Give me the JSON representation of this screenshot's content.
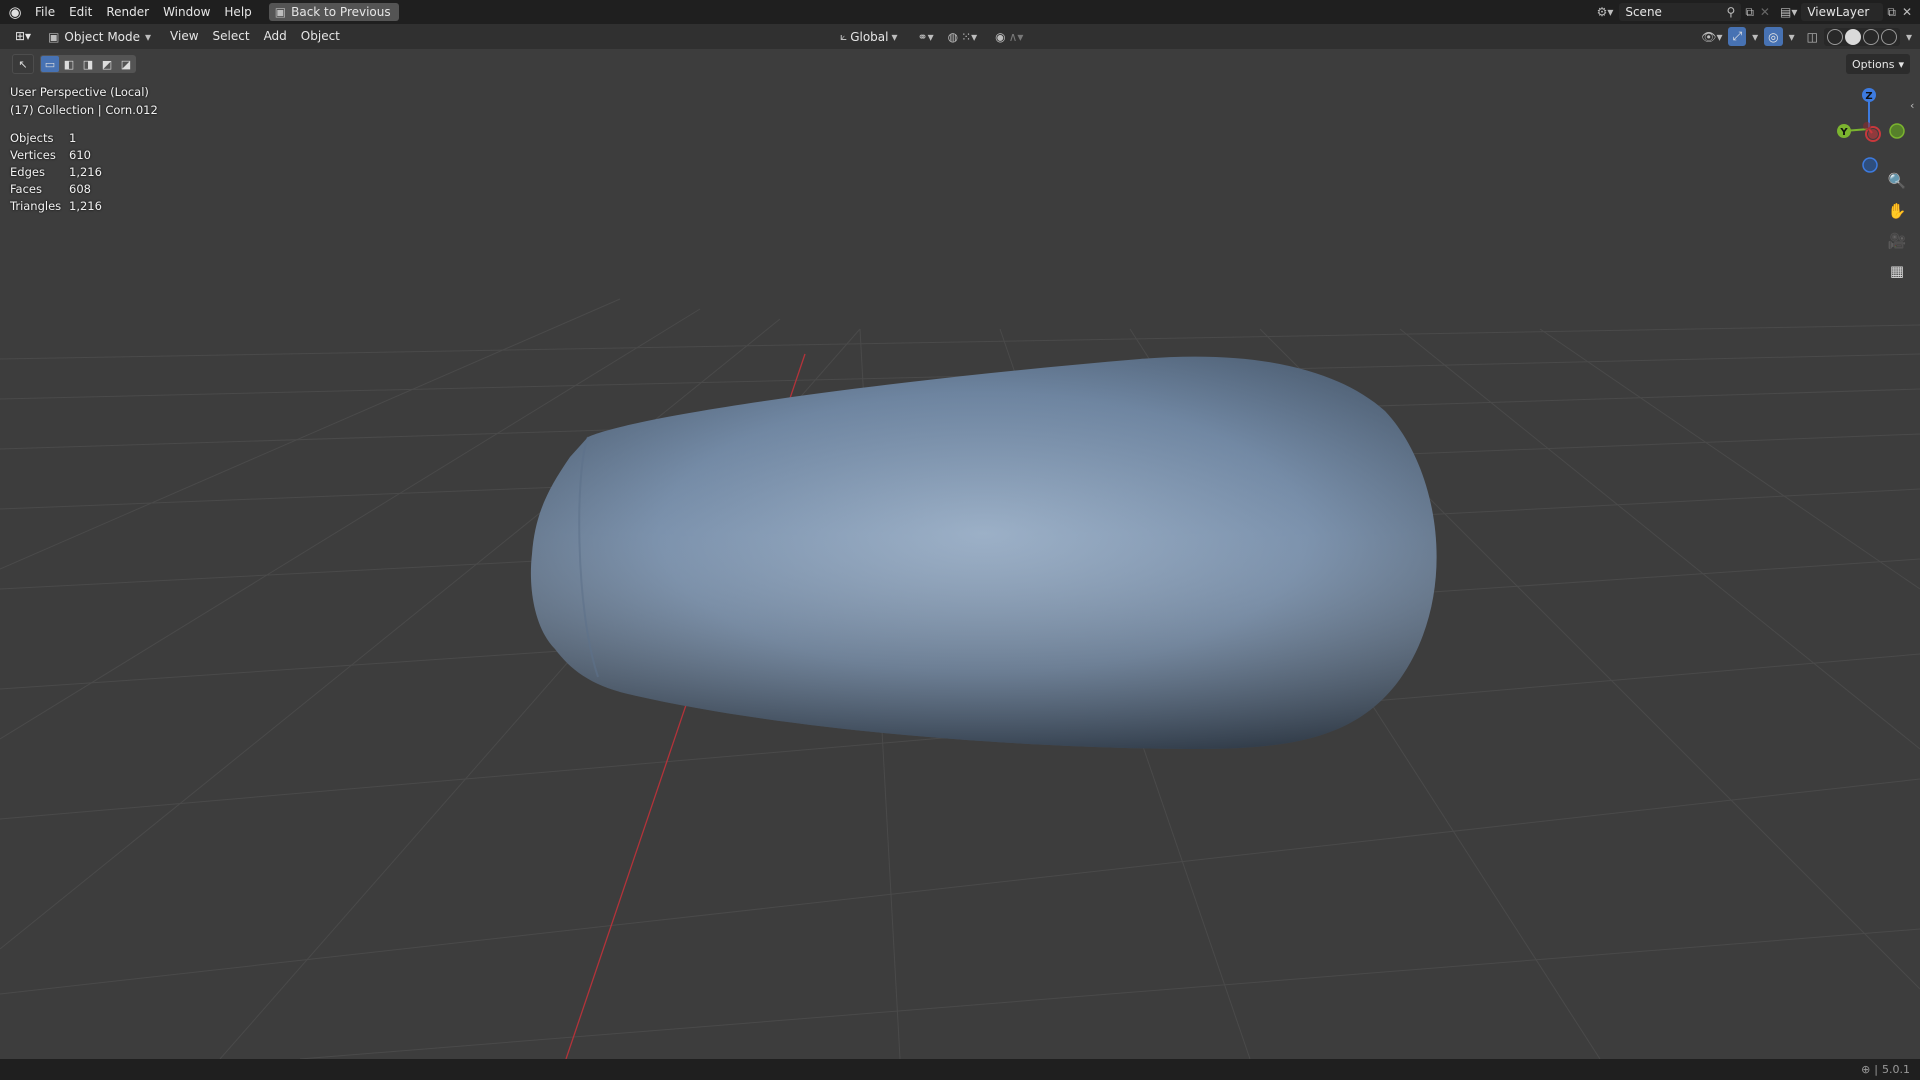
{
  "menu": {
    "items": [
      "File",
      "Edit",
      "Render",
      "Window",
      "Help"
    ],
    "back_button": "Back to Previous"
  },
  "top_right": {
    "scene": "Scene",
    "view_layer": "ViewLayer"
  },
  "header": {
    "mode": "Object Mode",
    "menus": [
      "View",
      "Select",
      "Add",
      "Object"
    ],
    "orientation": "Global",
    "options": "Options"
  },
  "viewport": {
    "perspective": "User Perspective (Local)",
    "collection": "(17) Collection | Corn.012",
    "stats": [
      {
        "label": "Objects",
        "value": "1"
      },
      {
        "label": "Vertices",
        "value": "610"
      },
      {
        "label": "Edges",
        "value": "1,216"
      },
      {
        "label": "Faces",
        "value": "608"
      },
      {
        "label": "Triangles",
        "value": "1,216"
      }
    ],
    "gizmo": {
      "z": "Z",
      "y": "Y"
    }
  },
  "status": {
    "version": "5.0.1"
  },
  "colors": {
    "accent": "#4772b3",
    "mesh": "#7189a6",
    "x_axis": "#c8383c",
    "y_axis": "#7bb42f",
    "z_axis": "#3d7be0"
  },
  "icons": {
    "logo": "blender-logo-icon",
    "zoom": "zoom-icon",
    "pan": "hand-icon",
    "camera": "camera-icon",
    "perspective": "grid-icon"
  }
}
